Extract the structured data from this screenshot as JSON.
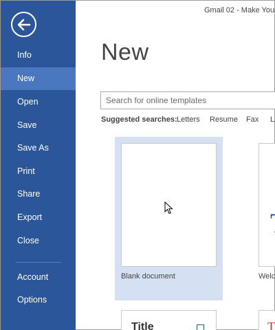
{
  "window": {
    "title": "Gmail 02 - Make Your"
  },
  "sidebar": {
    "back_icon": "back-arrow-icon",
    "items": [
      {
        "label": "Info"
      },
      {
        "label": "New",
        "selected": true
      },
      {
        "label": "Open"
      },
      {
        "label": "Save"
      },
      {
        "label": "Save As"
      },
      {
        "label": "Print"
      },
      {
        "label": "Share"
      },
      {
        "label": "Export"
      },
      {
        "label": "Close"
      },
      {
        "label": "Account"
      },
      {
        "label": "Options"
      }
    ]
  },
  "main": {
    "title": "New",
    "search": {
      "placeholder": "Search for online templates",
      "value": ""
    },
    "suggested": {
      "label": "Suggested searches:",
      "links": [
        "Letters",
        "Resume",
        "Fax",
        "La"
      ]
    },
    "templates": [
      {
        "caption": "Blank document",
        "selected": true
      },
      {
        "caption": "Welco",
        "glyph": "T"
      }
    ],
    "second_row": [
      {
        "text": "Title"
      },
      {
        "text": "T"
      }
    ]
  },
  "colors": {
    "sidebar_bg": "#2b579a",
    "sidebar_selected": "#4a78c0",
    "tile_selected": "#d5e1f2"
  }
}
